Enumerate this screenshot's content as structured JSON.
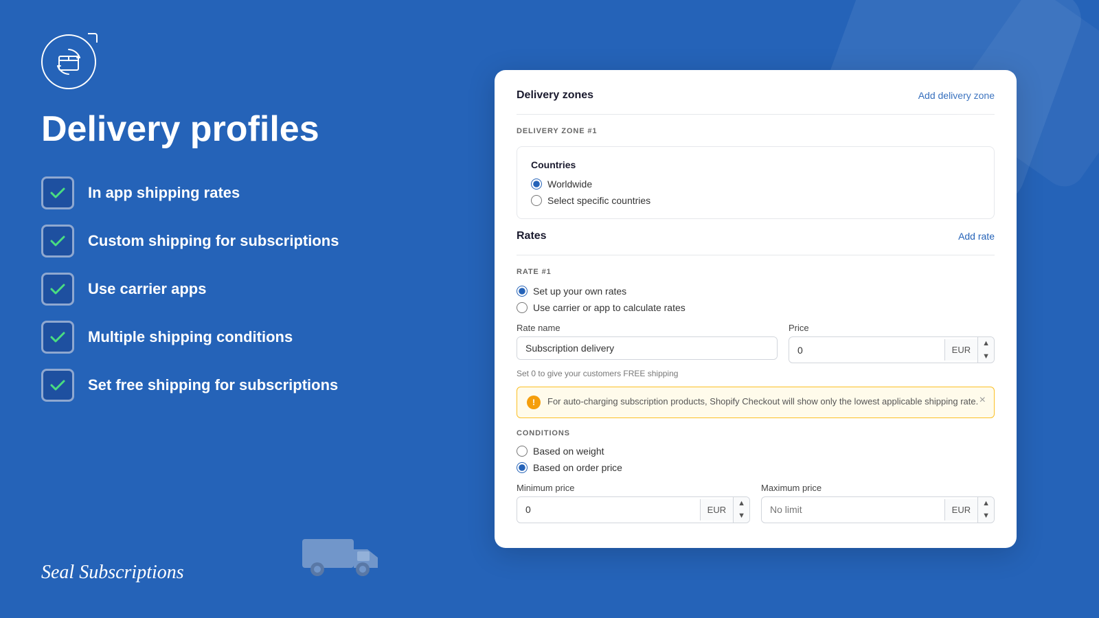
{
  "background": {
    "color": "#2563b8"
  },
  "left": {
    "title": "Delivery profiles",
    "features": [
      "In app shipping rates",
      "Custom shipping for subscriptions",
      "Use carrier apps",
      "Multiple shipping conditions",
      "Set free shipping for subscriptions"
    ],
    "brand": "Seal Subscriptions"
  },
  "card": {
    "delivery_zones_title": "Delivery zones",
    "add_delivery_zone": "Add delivery zone",
    "zone_label": "DELIVERY ZONE #1",
    "countries": {
      "title": "Countries",
      "options": [
        "Worldwide",
        "Select specific countries"
      ],
      "selected": "Worldwide"
    },
    "rates": {
      "title": "Rates",
      "add_rate": "Add rate",
      "rate_label": "RATE #1",
      "rate_options": [
        "Set up your own rates",
        "Use carrier or app to calculate rates"
      ],
      "selected": "Set up your own rates",
      "rate_name_label": "Rate name",
      "rate_name_value": "Subscription delivery",
      "price_label": "Price",
      "price_value": "0",
      "currency": "EUR",
      "free_shipping_hint": "Set 0 to give your customers FREE shipping",
      "alert_text": "For auto-charging subscription products, Shopify Checkout will show only the lowest applicable shipping rate."
    },
    "conditions": {
      "label": "CONDITIONS",
      "options": [
        "Based on weight",
        "Based on order price"
      ],
      "selected": "Based on order price",
      "min_price_label": "Minimum price",
      "min_price_value": "0",
      "max_price_label": "Maximum price",
      "max_price_placeholder": "No limit",
      "currency": "EUR"
    }
  }
}
